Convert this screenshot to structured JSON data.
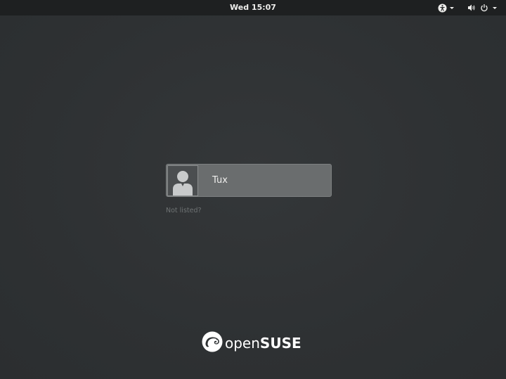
{
  "topbar": {
    "clock": "Wed 15:07",
    "accessibility_icon": "accessibility-icon",
    "volume_icon": "volume-icon",
    "power_icon": "power-icon"
  },
  "login": {
    "users": [
      {
        "name": "Tux",
        "avatar_icon": "default-user-avatar-icon"
      }
    ],
    "not_listed_label": "Not listed?"
  },
  "branding": {
    "logo_icon": "opensuse-chameleon-icon",
    "logo_text_light": "open",
    "logo_text_bold": "SUSE"
  },
  "colors": {
    "background": "#2f3234",
    "topbar": "#1e2021",
    "user_item": "#6a6d6e",
    "text": "#eeeeec",
    "muted_text": "#6f7374"
  }
}
